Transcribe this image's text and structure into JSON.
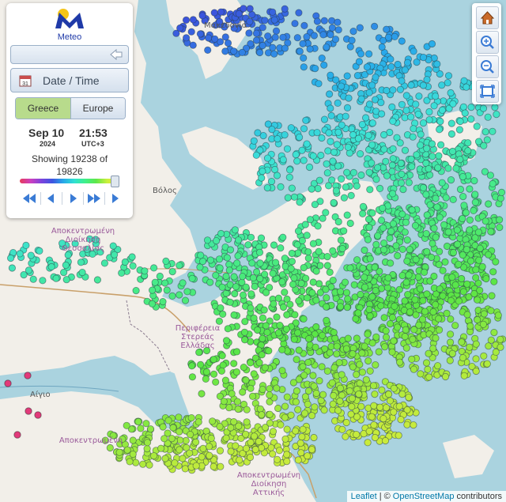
{
  "app": {
    "logo_text": "Meteo",
    "date_time_label": "Date / Time",
    "tabs": [
      {
        "label": "Greece",
        "active": true
      },
      {
        "label": "Europe",
        "active": false
      }
    ],
    "date": "Sep 10",
    "year": "2024",
    "time": "21:53",
    "timezone": "UTC+3",
    "showing_prefix": "Showing",
    "showing_count": "19238",
    "showing_of": "of",
    "showing_total": "19826",
    "time_slider_position": 0.97,
    "playback_buttons": [
      "fast-rewind",
      "step-back",
      "play",
      "fast-forward",
      "step-forward"
    ]
  },
  "map_controls": [
    {
      "name": "home",
      "icon": "home-icon"
    },
    {
      "name": "zoom-in",
      "icon": "zoom-in-icon"
    },
    {
      "name": "zoom-out",
      "icon": "zoom-out-icon"
    },
    {
      "name": "fit-bounds",
      "icon": "fit-bounds-icon"
    }
  ],
  "map_labels": {
    "volos": "Βόλος",
    "aigio": "Αίγιο",
    "region_sterea_1": "Περιφέρεια",
    "region_sterea_2": "Στερεάς",
    "region_sterea_3": "Ελλάδας",
    "region_attiki_1": "Αποκεντρωμένη",
    "region_attiki_2": "Διοίκηση",
    "region_attiki_3": "Αττικής",
    "top_region": "Μακεδονία",
    "west_region": "Αποκεντρωμένη",
    "west_region_2": "Διοίκηση",
    "west_region_3": "Θεσσαλίας",
    "south_region": "Αποκεντρωμένη"
  },
  "attribution": {
    "leaflet": "Leaflet",
    "separator": "| ©",
    "osm": "OpenStreetMap",
    "contributors": "contributors"
  },
  "colors": {
    "sea": "#aad3df",
    "land": "#f2efe9",
    "greece_tab_active": "#b8db8c",
    "logo_blue": "#1f3aa8",
    "logo_sun": "#f5c518"
  }
}
